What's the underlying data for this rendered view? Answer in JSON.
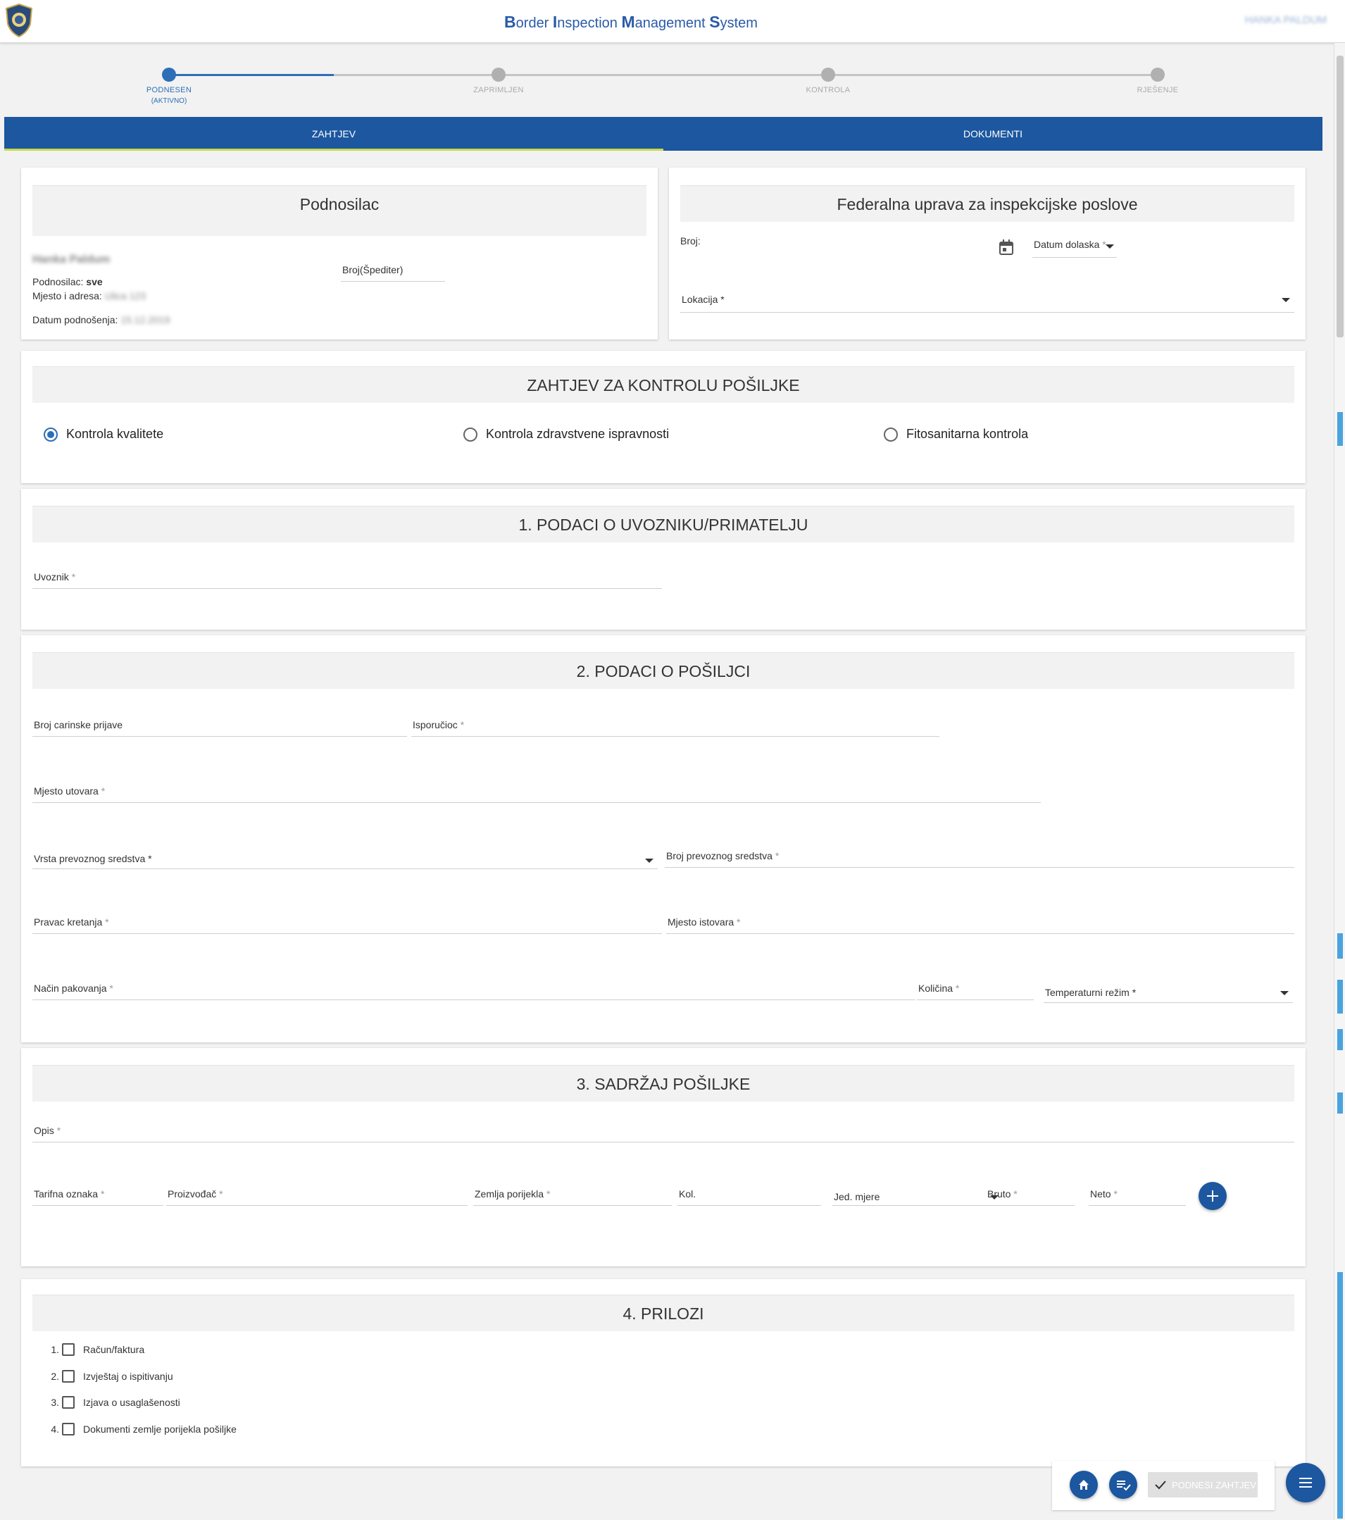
{
  "header": {
    "title_parts": [
      {
        "cap": "B",
        "rest": "order "
      },
      {
        "cap": "I",
        "rest": "nspection "
      },
      {
        "cap": "M",
        "rest": "anagement "
      },
      {
        "cap": "S",
        "rest": "ystem"
      }
    ],
    "user": "HANKA PALDUM"
  },
  "stepper": {
    "steps": [
      {
        "label": "PODNESEN",
        "sub": "(AKTIVNO)"
      },
      {
        "label": "ZAPRIMLJEN"
      },
      {
        "label": "KONTROLA"
      },
      {
        "label": "RJEŠENJE"
      }
    ]
  },
  "tabs": [
    "ZAHTJEV",
    "DOKUMENTI"
  ],
  "podnosilac": {
    "title": "Podnosilac",
    "name": "Hanka Paldum",
    "type_label": "Podnosilac:",
    "type_value": "sve",
    "address_label": "Mjesto i adresa:",
    "address_value": "Ulica 123",
    "date_label": "Datum podnošenja:",
    "date_value": "15.12.2019",
    "spediter_label": "Broj(Špediter)"
  },
  "uprava": {
    "title": "Federalna uprava za inspekcijske poslove",
    "broj_label": "Broj:",
    "datum_label": "Datum dolaska",
    "lokacija_label": "Lokacija"
  },
  "kontrola": {
    "title": "ZAHTJEV ZA KONTROLU POŠILJKE",
    "options": [
      "Kontrola kvalitete",
      "Kontrola zdravstvene ispravnosti",
      "Fitosanitarna kontrola"
    ],
    "selected": "Kontrola kvalitete"
  },
  "uvoznik": {
    "title": "1. PODACI O UVOZNIKU/PRIMATELJU",
    "uvoznik_label": "Uvoznik"
  },
  "posiljka": {
    "title": "2. PODACI O POŠILJCI",
    "broj_carinske": "Broj carinske prijave",
    "isporucioc": "Isporučioc",
    "mjesto_utovara": "Mjesto utovara",
    "vrsta_prevoznog": "Vrsta prevoznog sredstva",
    "broj_prevoznog": "Broj prevoznog sredstva",
    "pravac_kretanja": "Pravac kretanja",
    "mjesto_istovara": "Mjesto istovara",
    "nacin_pakovanja": "Način pakovanja",
    "kolicina": "Količina",
    "temperaturni_rezim": "Temperaturni režim"
  },
  "sadrzaj": {
    "title": "3. SADRŽAJ POŠILJKE",
    "opis": "Opis",
    "tarifna_oznaka": "Tarifna oznaka",
    "proizvodjac": "Proizvođač",
    "zemlja_porijekla": "Zemlja porijekla",
    "kol": "Kol.",
    "jed_mjere": "Jed. mjere",
    "bruto": "Bruto",
    "neto": "Neto",
    "add_icon": "plus-icon"
  },
  "prilozi": {
    "title": "4. PRILOZI",
    "items": [
      {
        "num": "1.",
        "label": "Račun/faktura"
      },
      {
        "num": "2.",
        "label": "Izvještaj o ispitivanju"
      },
      {
        "num": "3.",
        "label": "Izjava o usaglašenosti"
      },
      {
        "num": "4.",
        "label": "Dokumenti zemlje porijekla pošiljke"
      }
    ]
  },
  "actions": {
    "submit_label": "PODNESI ZAHTJEV",
    "home_icon": "home-icon",
    "checklist_icon": "checklist-icon",
    "menu_icon": "menu-icon"
  },
  "colors": {
    "primary": "#1c57a0",
    "accent": "#2c6fb7",
    "tab_indicator": "#c8d94a"
  }
}
